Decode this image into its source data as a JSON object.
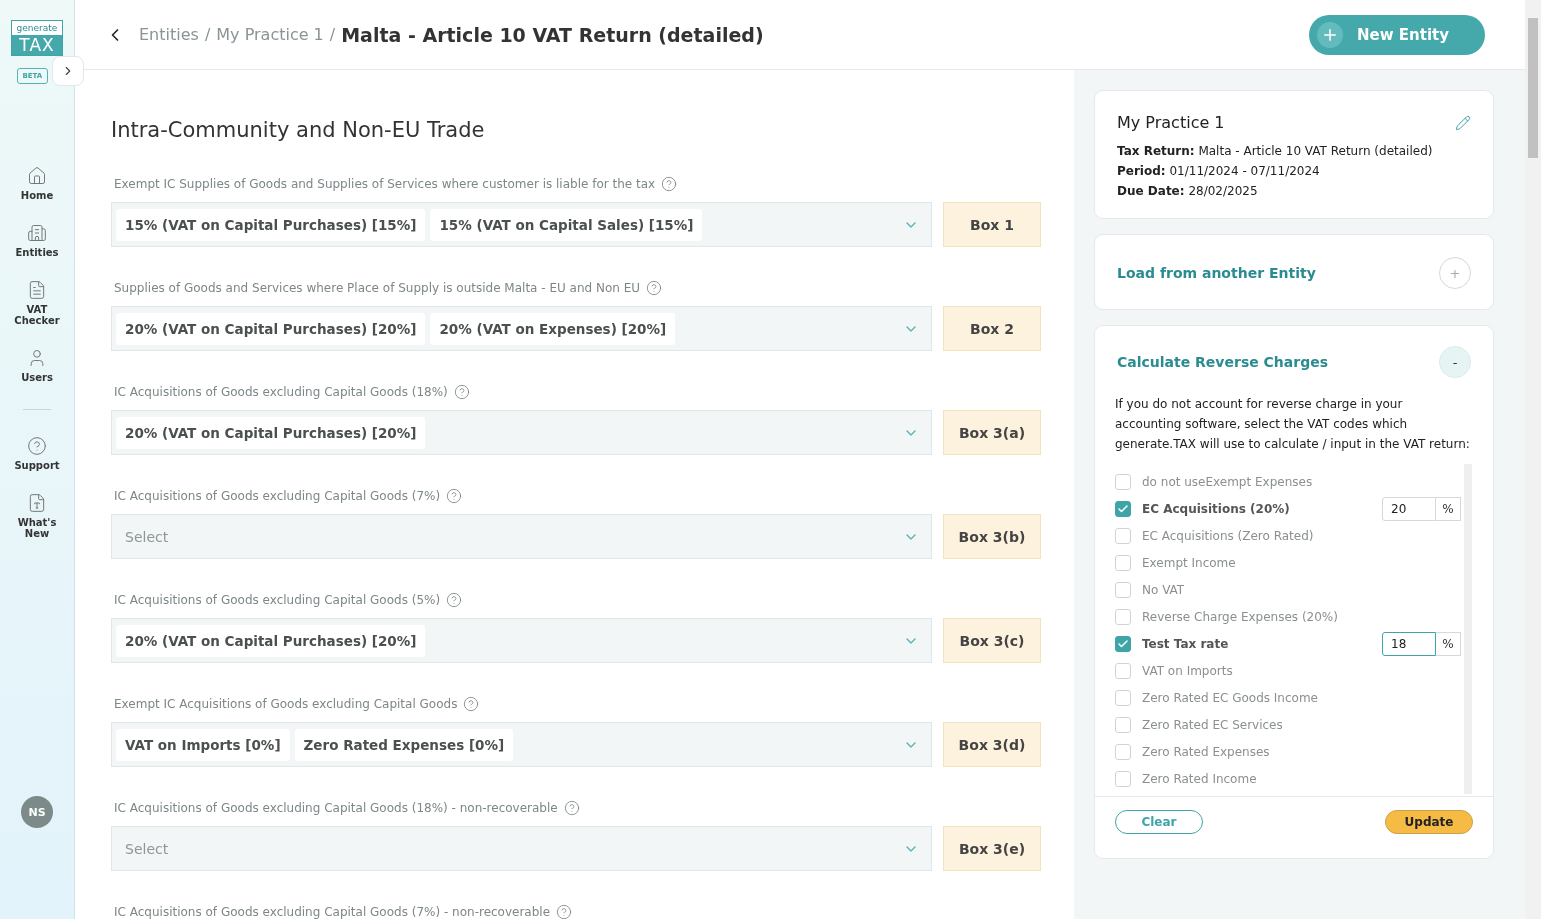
{
  "sidebar": {
    "logo": {
      "top": "generate",
      "bottom": "TAX"
    },
    "badge": "BETA",
    "items": [
      {
        "kind": "home",
        "label": "Home"
      },
      {
        "kind": "entities",
        "label": "Entities"
      },
      {
        "kind": "checker",
        "label": "VAT Checker"
      },
      {
        "kind": "users",
        "label": "Users"
      },
      {
        "kind": "divider"
      },
      {
        "kind": "support",
        "label": "Support"
      },
      {
        "kind": "news",
        "label": "What's New"
      }
    ],
    "avatar": "NS"
  },
  "header": {
    "breadcrumb": [
      "Entities",
      "My Practice 1"
    ],
    "separator": "/",
    "title": "Malta - Article 10 VAT Return (detailed)",
    "new_button": "New Entity"
  },
  "section": {
    "title": "Intra-Community and Non-EU Trade",
    "fields": [
      {
        "label": "Exempt IC Supplies of Goods and Supplies of Services where customer is liable for the tax",
        "tags": [
          "15% (VAT on Capital Purchases) [15%]",
          "15% (VAT on Capital Sales) [15%]"
        ],
        "box": "Box 1"
      },
      {
        "label": "Supplies of Goods and Services where Place of Supply is outside Malta - EU and Non EU",
        "tags": [
          "20% (VAT on Capital Purchases) [20%]",
          "20% (VAT on Expenses) [20%]"
        ],
        "box": "Box 2"
      },
      {
        "label": "IC Acquisitions of Goods excluding Capital Goods (18%)",
        "tags": [
          "20% (VAT on Capital Purchases) [20%]"
        ],
        "box": "Box 3(a)"
      },
      {
        "label": "IC Acquisitions of Goods excluding Capital Goods (7%)",
        "placeholder": "Select",
        "box": "Box 3(b)"
      },
      {
        "label": "IC Acquisitions of Goods excluding Capital Goods (5%)",
        "tags": [
          "20% (VAT on Capital Purchases) [20%]"
        ],
        "box": "Box 3(c)"
      },
      {
        "label": "Exempt IC Acquisitions of Goods excluding Capital Goods",
        "tags": [
          "VAT on Imports [0%]",
          "Zero Rated Expenses [0%]"
        ],
        "box": "Box 3(d)"
      },
      {
        "label": "IC Acquisitions of Goods excluding Capital Goods (18%) - non-recoverable",
        "placeholder": "Select",
        "box": "Box 3(e)"
      },
      {
        "label": "IC Acquisitions of Goods excluding Capital Goods (7%) - non-recoverable"
      }
    ]
  },
  "info_card": {
    "title": "My Practice 1",
    "rows": [
      {
        "key": "Tax Return:",
        "value": "Malta - Article 10 VAT Return (detailed)"
      },
      {
        "key": "Period:",
        "value": "01/11/2024 - 07/11/2024"
      },
      {
        "key": "Due Date:",
        "value": "28/02/2025"
      }
    ]
  },
  "load_card": {
    "title": "Load from another Entity",
    "expanded": false,
    "toggle": "+"
  },
  "reverse_card": {
    "title": "Calculate Reverse Charges",
    "expanded": true,
    "toggle": "-",
    "description": "If you do not account for reverse charge in your accounting software, select the VAT codes which generate.TAX will use to calculate / input in the VAT return:",
    "codes": [
      {
        "label": "do not useExempt Expenses",
        "checked": false
      },
      {
        "label": "EC Acquisitions (20%)",
        "checked": true,
        "rate": {
          "value": "20",
          "unit": "%",
          "focused": false
        }
      },
      {
        "label": "EC Acquisitions (Zero Rated)",
        "checked": false
      },
      {
        "label": "Exempt Income",
        "checked": false
      },
      {
        "label": "No VAT",
        "checked": false
      },
      {
        "label": "Reverse Charge Expenses (20%)",
        "checked": false
      },
      {
        "label": "Test Tax rate",
        "checked": true,
        "rate": {
          "value": "18",
          "unit": "%",
          "focused": true
        }
      },
      {
        "label": "VAT on Imports",
        "checked": false
      },
      {
        "label": "Zero Rated EC Goods Income",
        "checked": false
      },
      {
        "label": "Zero Rated EC Services",
        "checked": false
      },
      {
        "label": "Zero Rated Expenses",
        "checked": false
      },
      {
        "label": "Zero Rated Income",
        "checked": false
      }
    ],
    "clear_button": "Clear",
    "update_button": "Update"
  }
}
